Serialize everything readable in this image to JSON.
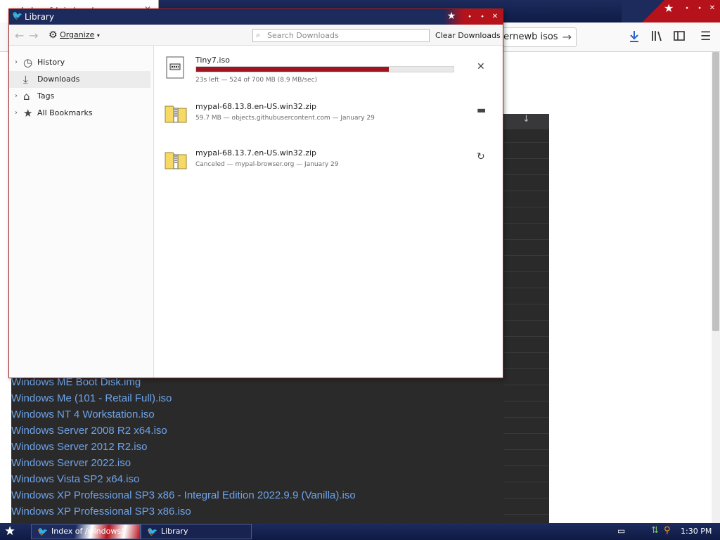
{
  "browser": {
    "tab_title": "Index of /windows/",
    "url_fragment": "ternewb isos",
    "content_header_symbol": "↓",
    "files": [
      "Windows ME Boot Disk.img",
      "Windows Me (101 - Retail Full).iso",
      "Windows NT 4 Workstation.iso",
      "Windows Server 2008 R2 x64.iso",
      "Windows Server 2012 R2.iso",
      "Windows Server 2022.iso",
      "Windows Vista SP2 x64.iso",
      "Windows XP Professional SP3 x86 - Integral Edition 2022.9.9 (Vanilla).iso",
      "Windows XP Professional SP3 x86.iso"
    ]
  },
  "library": {
    "title": "Library",
    "organize_label": "Organize",
    "search_placeholder": "Search Downloads",
    "clear_label": "Clear Downloads",
    "sidebar": [
      {
        "label": "History",
        "icon": "clock-icon",
        "twisty": true,
        "selected": false
      },
      {
        "label": "Downloads",
        "icon": "download-icon",
        "twisty": false,
        "selected": true
      },
      {
        "label": "Tags",
        "icon": "tag-icon",
        "twisty": true,
        "selected": false
      },
      {
        "label": "All Bookmarks",
        "icon": "star-icon",
        "twisty": true,
        "selected": false
      }
    ],
    "downloads": [
      {
        "name": "Tiny7.iso",
        "status": "23s left — 524 of 700 MB (8.9 MB/sec)",
        "progress": 0.748,
        "action_icon": "cancel-icon"
      },
      {
        "name": "mypal-68.13.8.en-US.win32.zip",
        "status": "59.7 MB — objects.githubusercontent.com — January 29",
        "action_icon": "folder-icon"
      },
      {
        "name": "mypal-68.13.7.en-US.win32.zip",
        "status": "Canceled — mypal-browser.org — January 29",
        "action_icon": "retry-icon"
      }
    ]
  },
  "taskbar": {
    "tasks": [
      "Index of /windows/",
      "Library"
    ],
    "clock": "1:30 PM"
  },
  "colors": {
    "accent_red": "#a01420",
    "navy": "#1c2a5c",
    "link_blue": "#6ea3e8"
  }
}
